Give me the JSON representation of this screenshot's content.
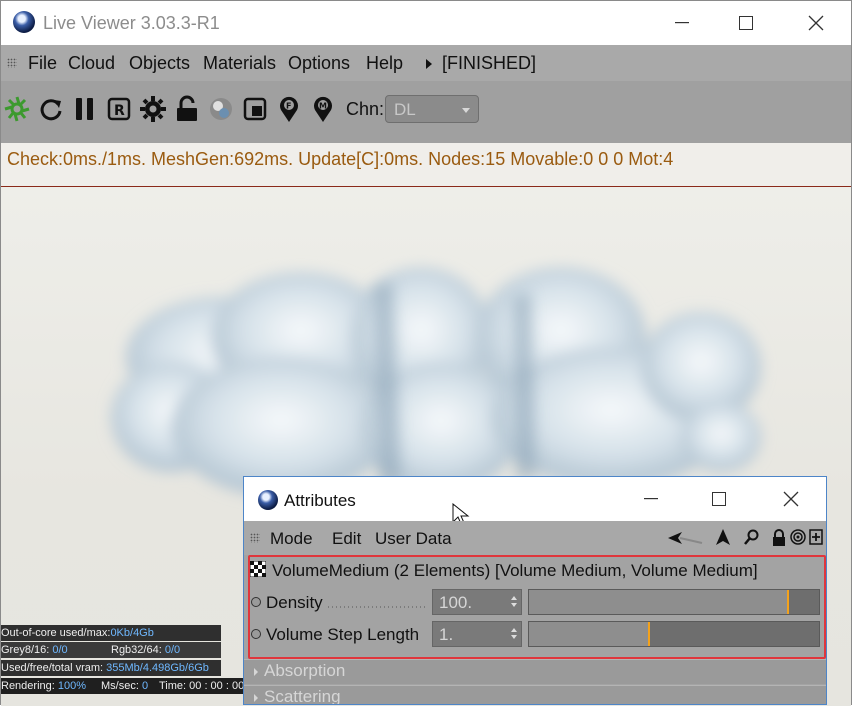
{
  "main_window": {
    "title": "Live Viewer 3.03.3-R1",
    "menu": [
      "File",
      "Cloud",
      "Objects",
      "Materials",
      "Options",
      "Help"
    ],
    "run_state": "[FINISHED]",
    "toolbar_icons": [
      "render-start-icon",
      "refresh-icon",
      "pause-icon",
      "region-icon",
      "settings-icon",
      "lock-icon",
      "material-preview-icon",
      "clay-icon",
      "focus-pin-icon",
      "material-pin-icon"
    ],
    "channel_label": "Chn:",
    "channel_value": "DL",
    "status": "Check:0ms./1ms. MeshGen:692ms. Update[C]:0ms. Nodes:15 Movable:0  0 0 Mot:4"
  },
  "stats": {
    "out_of_core_label": "Out-of-core used/max:",
    "out_of_core_value": "0Kb/4Gb",
    "grey_label": "Grey8/16:",
    "grey_value": "0/0",
    "rgb_label": "Rgb32/64:",
    "rgb_value": "0/0",
    "vram_label": "Used/free/total vram:",
    "vram_value": "355Mb/4.498Gb/6Gb",
    "rendering_label": "Rendering:",
    "rendering_value": "100%",
    "ms_label": "Ms/sec:",
    "ms_value": "0",
    "time_label": "Time:",
    "time_value": "00 : 00 : 00"
  },
  "attributes": {
    "title": "Attributes",
    "menu": [
      "Mode",
      "Edit",
      "User Data"
    ],
    "object_header": "VolumeMedium (2 Elements) [Volume Medium, Volume Medium]",
    "params": [
      {
        "label": "Density",
        "value": "100.",
        "slider_fraction": 0.89
      },
      {
        "label": "Volume Step Length",
        "value": "1.",
        "slider_fraction": 0.41
      }
    ],
    "groups": [
      "Absorption",
      "Scattering"
    ]
  }
}
